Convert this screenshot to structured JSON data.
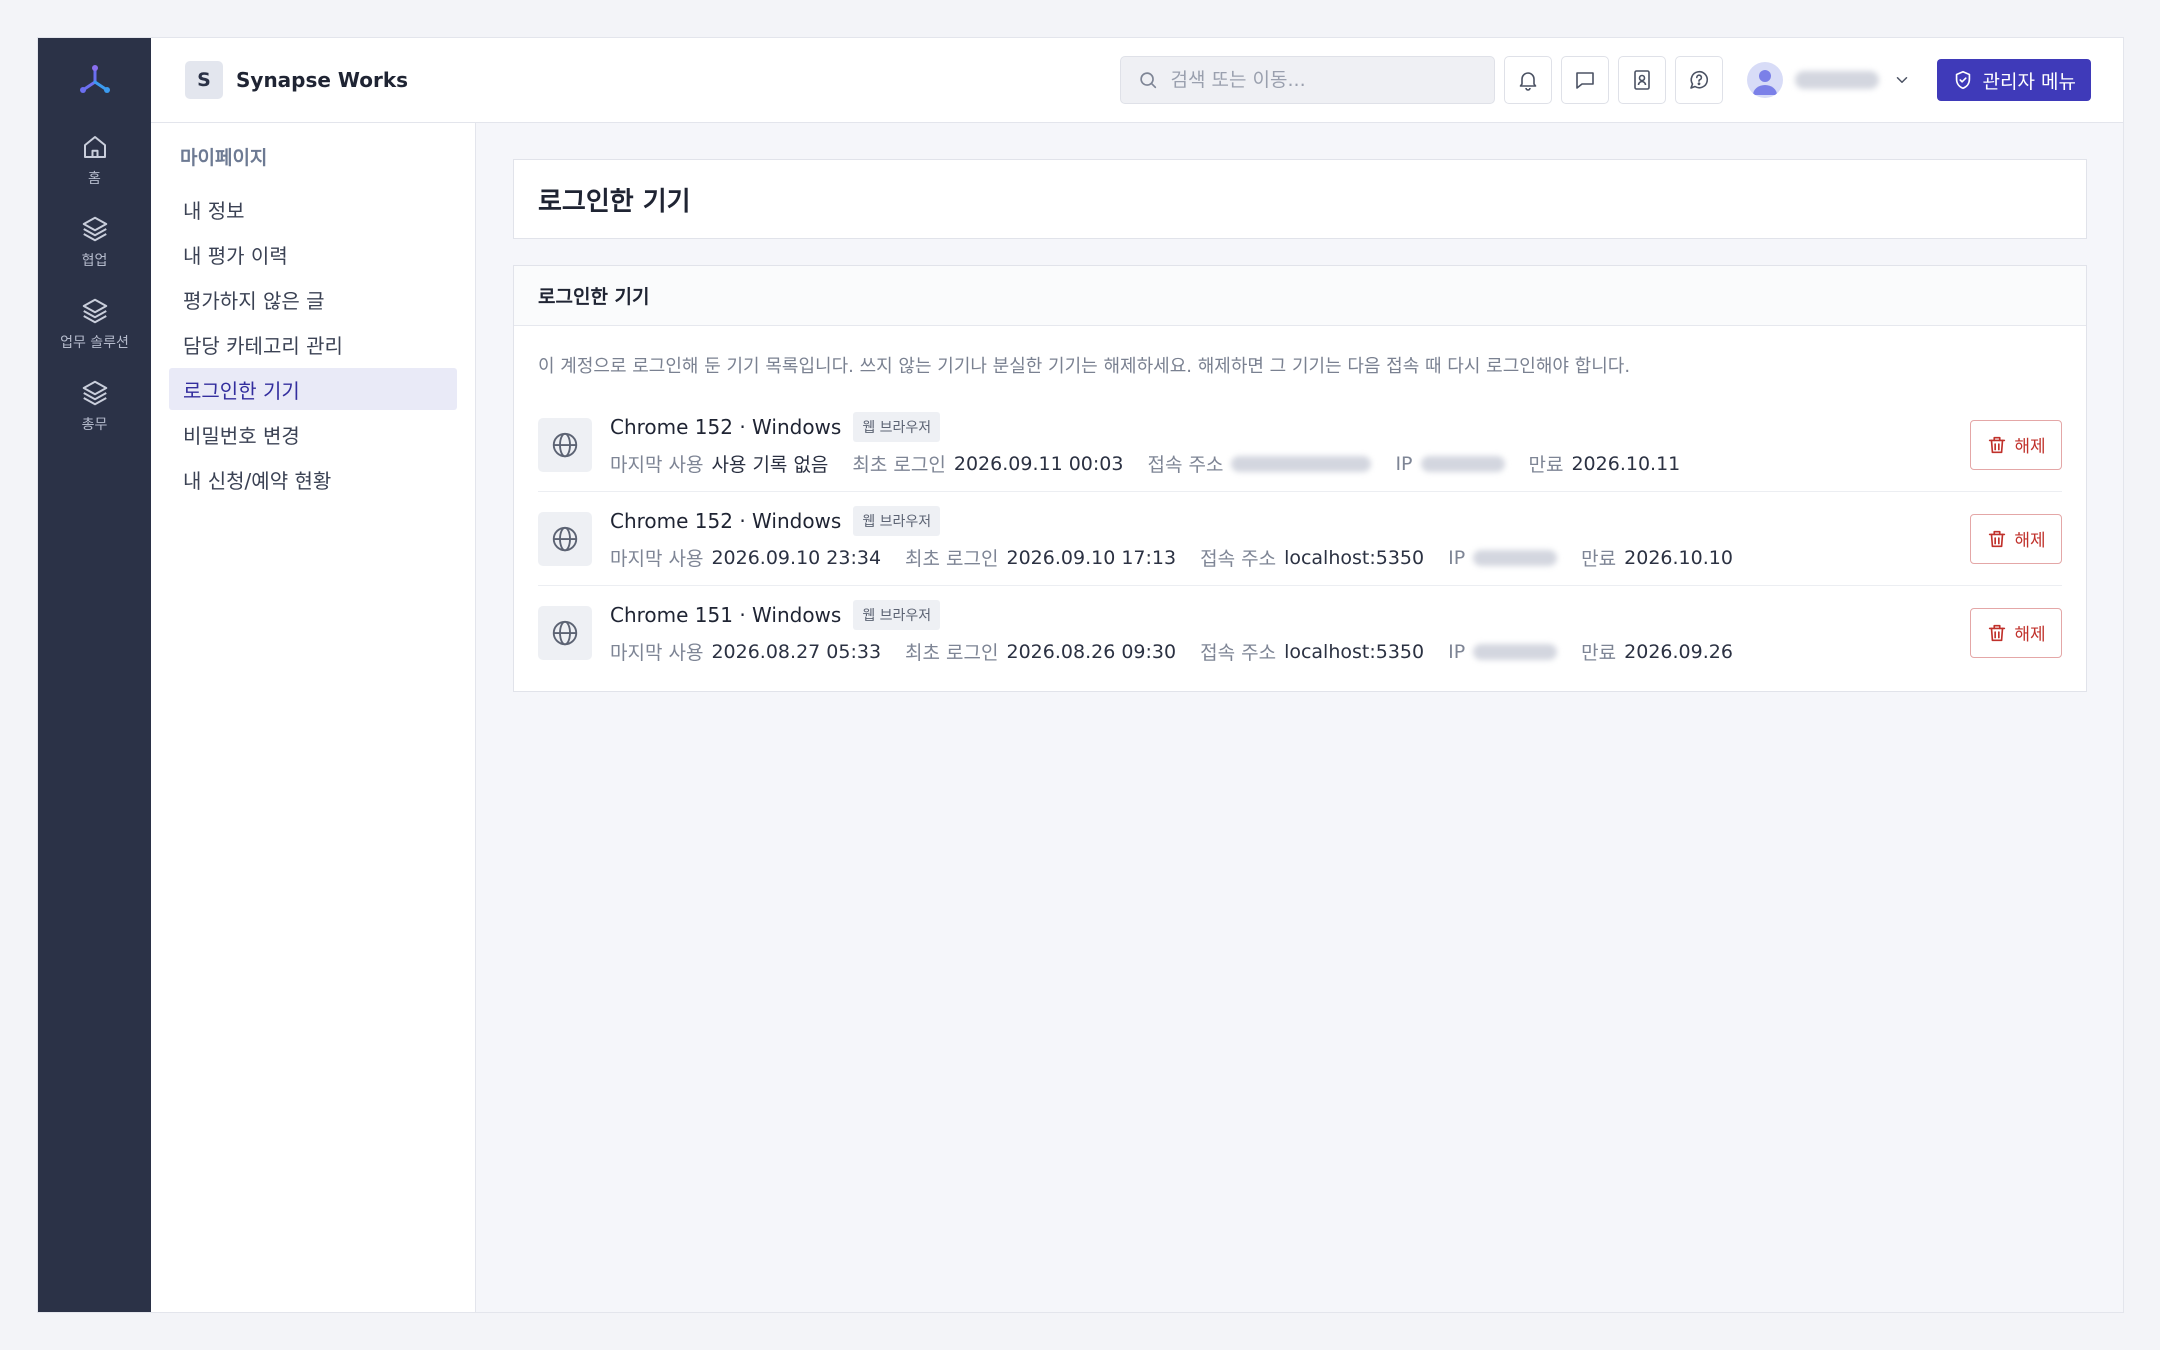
{
  "rail": {
    "items": [
      {
        "label": "홈",
        "icon": "home-icon"
      },
      {
        "label": "협업",
        "icon": "layers-icon"
      },
      {
        "label": "업무 솔루션",
        "icon": "layers-icon"
      },
      {
        "label": "총무",
        "icon": "layers-icon"
      }
    ]
  },
  "header": {
    "org_initial": "S",
    "org_name": "Synapse Works",
    "search_placeholder": "검색 또는 이동...",
    "admin_label": "관리자 메뉴"
  },
  "sidenav": {
    "title": "마이페이지",
    "items": [
      "내 정보",
      "내 평가 이력",
      "평가하지 않은 글",
      "담당 카테고리 관리",
      "로그인한 기기",
      "비밀번호 변경",
      "내 신청/예약 현황"
    ]
  },
  "page": {
    "title": "로그인한 기기",
    "card_title": "로그인한 기기",
    "description": "이 계정으로 로그인해 둔 기기 목록입니다. 쓰지 않는 기기나 분실한 기기는 해제하세요. 해제하면 그 기기는 다음 접속 때 다시 로그인해야 합니다.",
    "labels": {
      "last_used": "마지막 사용",
      "first_login": "최초 로그인",
      "address": "접속 주소",
      "ip": "IP",
      "expiry": "만료",
      "revoke": "해제"
    }
  },
  "devices": [
    {
      "name": "Chrome 152 · Windows",
      "tag": "웹 브라우저",
      "last_used": "사용 기록 없음",
      "first_login": "2026.09.11 00:03",
      "address": "",
      "ip": "",
      "expiry": "2026.10.11"
    },
    {
      "name": "Chrome 152 · Windows",
      "tag": "웹 브라우저",
      "last_used": "2026.09.10 23:34",
      "first_login": "2026.09.10 17:13",
      "address": "localhost:5350",
      "ip": "",
      "expiry": "2026.10.10"
    },
    {
      "name": "Chrome 151 · Windows",
      "tag": "웹 브라우저",
      "last_used": "2026.08.27 05:33",
      "first_login": "2026.08.26 09:30",
      "address": "localhost:5350",
      "ip": "",
      "expiry": "2026.09.26"
    }
  ],
  "colors": {
    "rail_bg": "#2b3247",
    "accent": "#3f3ab9",
    "danger": "#c0312b"
  }
}
